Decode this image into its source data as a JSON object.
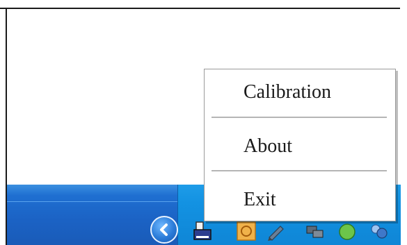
{
  "context_menu": {
    "items": [
      {
        "label": "Calibration"
      },
      {
        "label": "About"
      },
      {
        "label": "Exit"
      }
    ]
  },
  "taskbar": {
    "tray_expand_icon": "chevron-left-icon",
    "tray_icons": [
      "printer-icon",
      "orange-app-icon",
      "pen-icon",
      "network-icon",
      "green-app-icon",
      "blue-app-icon"
    ]
  },
  "colors": {
    "taskbar": "#1f6fd1",
    "tray": "#1392e2",
    "menu_background": "#ffffff",
    "separator": "#b5b5b5"
  }
}
